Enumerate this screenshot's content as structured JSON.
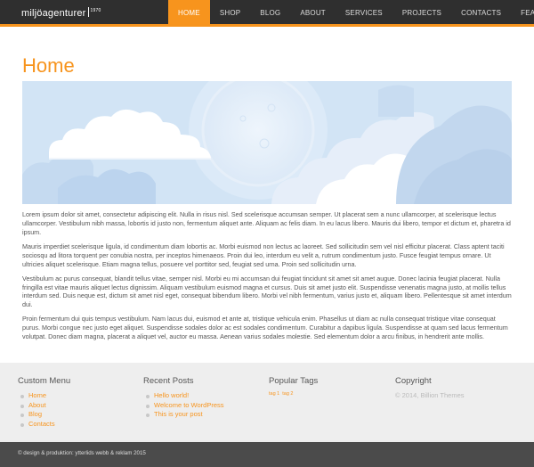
{
  "header": {
    "logo_text": "miljöagenturer",
    "logo_sup": "1970",
    "nav": [
      {
        "label": "Home",
        "active": true
      },
      {
        "label": "Shop",
        "active": false
      },
      {
        "label": "Blog",
        "active": false
      },
      {
        "label": "About",
        "active": false
      },
      {
        "label": "Services",
        "active": false
      },
      {
        "label": "Projects",
        "active": false
      },
      {
        "label": "Contacts",
        "active": false
      },
      {
        "label": "Features",
        "active": false
      }
    ],
    "accent_color": "#f7941d",
    "bar_color": "#2f2f2f"
  },
  "main": {
    "title": "Home",
    "paragraphs": [
      "Lorem ipsum dolor sit amet, consectetur adipiscing elit. Nulla in risus nisl. Sed scelerisque accumsan semper. Ut placerat sem a nunc ullamcorper, at scelerisque lectus ullamcorper. Vestibulum nibh massa, lobortis id justo non, fermentum aliquet ante. Aliquam ac felis diam. In eu lacus libero. Mauris dui libero, tempor et dictum et, pharetra id ipsum.",
      "Mauris imperdiet scelerisque ligula, id condimentum diam lobortis ac. Morbi euismod non lectus ac laoreet. Sed sollicitudin sem vel nisl efficitur placerat. Class aptent taciti sociosqu ad litora torquent per conubia nostra, per inceptos himenaeos. Proin dui leo, interdum eu velit a, rutrum condimentum justo. Fusce feugiat tempus ornare. Ut ultricies aliquet scelerisque. Etiam magna tellus, posuere vel porttitor sed, feugiat sed urna. Proin sed sollicitudin urna.",
      "Vestibulum ac purus consequat, blandit tellus vitae, semper nisl. Morbi eu mi accumsan dui feugiat tincidunt sit amet sit amet augue. Donec lacinia feugiat placerat. Nulla fringilla est vitae mauris aliquet lectus dignissim. Aliquam vestibulum euismod magna et cursus. Duis sit amet justo elit. Suspendisse venenatis magna justo, at mollis tellus interdum sed. Duis neque est, dictum sit amet nisl eget, consequat bibendum libero. Morbi vel nibh fermentum, varius justo et, aliquam libero. Pellentesque sit amet interdum dui.",
      "Proin fermentum dui quis tempus vestibulum. Nam lacus dui, euismod et ante at, tristique vehicula enim. Phasellus ut diam ac nulla consequat tristique vitae consequat purus. Morbi congue nec justo eget aliquet. Suspendisse sodales dolor ac est sodales condimentum. Curabitur a dapibus ligula. Suspendisse at quam sed lacus fermentum volutpat. Donec diam magna, placerat a aliquet vel, auctor eu massa. Aenean varius sodales molestie. Sed elementum dolor a arcu finibus, in hendrerit ante mollis."
    ]
  },
  "footer": {
    "custom_menu": {
      "title": "Custom Menu",
      "items": [
        "Home",
        "About",
        "Blog",
        "Contacts"
      ]
    },
    "recent_posts": {
      "title": "Recent Posts",
      "items": [
        "Hello world!",
        "Welcome to WordPress",
        "This is your post"
      ]
    },
    "popular_tags": {
      "title": "Popular Tags",
      "tags": [
        "tag 1",
        "tag 2"
      ]
    },
    "copyright": {
      "title": "Copyright",
      "text": "© 2014, Billion Themes"
    },
    "background_color": "#eeeeee"
  },
  "bottom_bar": {
    "credit": "© design & produktion: ytterlids webb & reklam 2015",
    "background_color": "#4b4b4b"
  }
}
